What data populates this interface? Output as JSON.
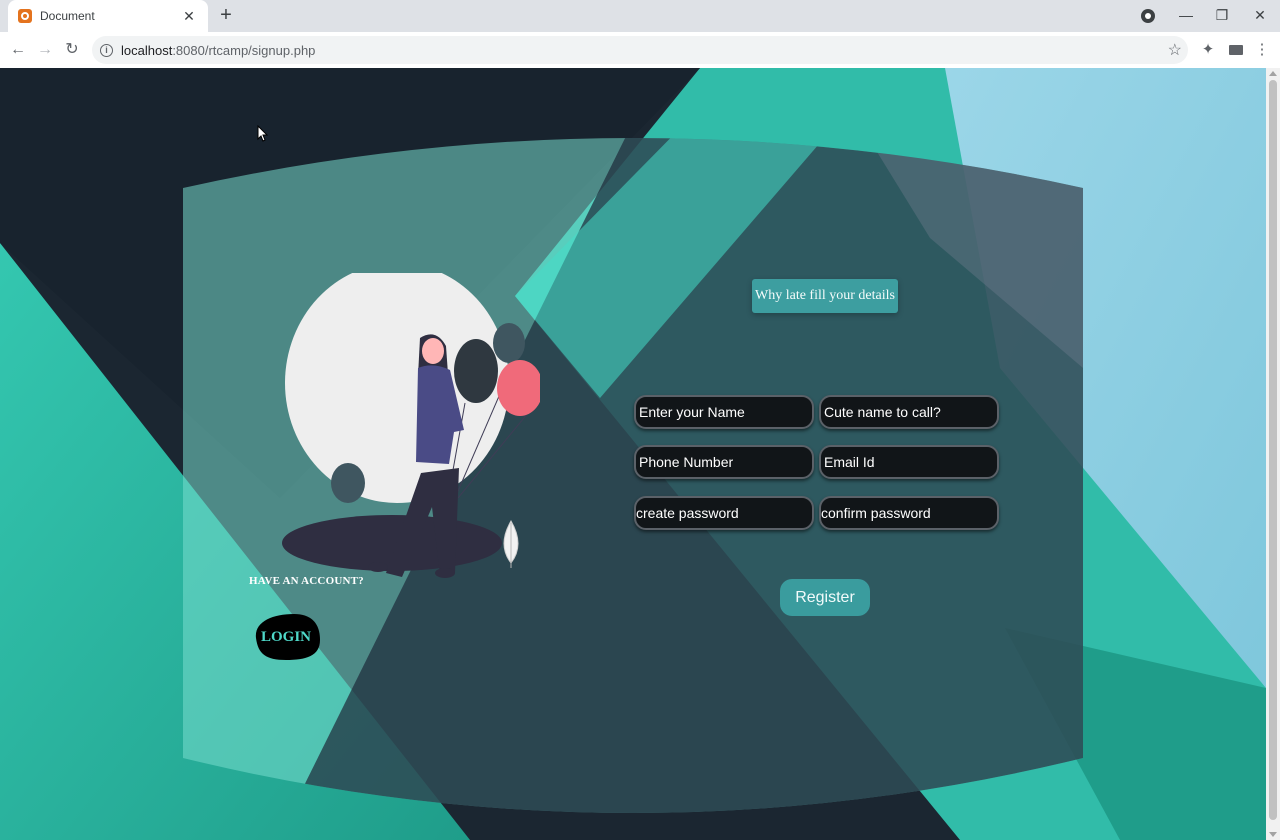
{
  "browser": {
    "tab_title": "Document",
    "tab_close": "✕",
    "new_tab": "+",
    "url_host": "localhost",
    "url_path": ":8080/rtcamp/signup.php",
    "window_controls": {
      "minimize": "—",
      "restore": "❐",
      "close": "✕"
    },
    "nav": {
      "back": "←",
      "forward": "→",
      "reload": "↻"
    },
    "icons": {
      "star": "☆",
      "extensions": "✦",
      "menu": "⋮"
    }
  },
  "page": {
    "colors": {
      "background_dark": "#1a2530",
      "teal": "#2fb7a3",
      "teal_light": "#4fd8c9",
      "light_blue": "#8fd3e8",
      "field_bg": "#111518",
      "button_teal": "#3a9c9e"
    },
    "banner_text": "Why late fill your details",
    "form": {
      "fields": [
        {
          "name": "name-field",
          "placeholder": "Enter your Name"
        },
        {
          "name": "nickname-field",
          "placeholder": "Cute name to call?"
        },
        {
          "name": "phone-field",
          "placeholder": "Phone Number"
        },
        {
          "name": "email-field",
          "placeholder": "Email Id"
        },
        {
          "name": "password-field",
          "placeholder": "create password"
        },
        {
          "name": "confirm-password-field",
          "placeholder": "confirm password"
        }
      ],
      "register_label": "Register"
    },
    "have_account_text": "HAVE AN ACCOUNT?",
    "login_label": "LOGIN"
  }
}
